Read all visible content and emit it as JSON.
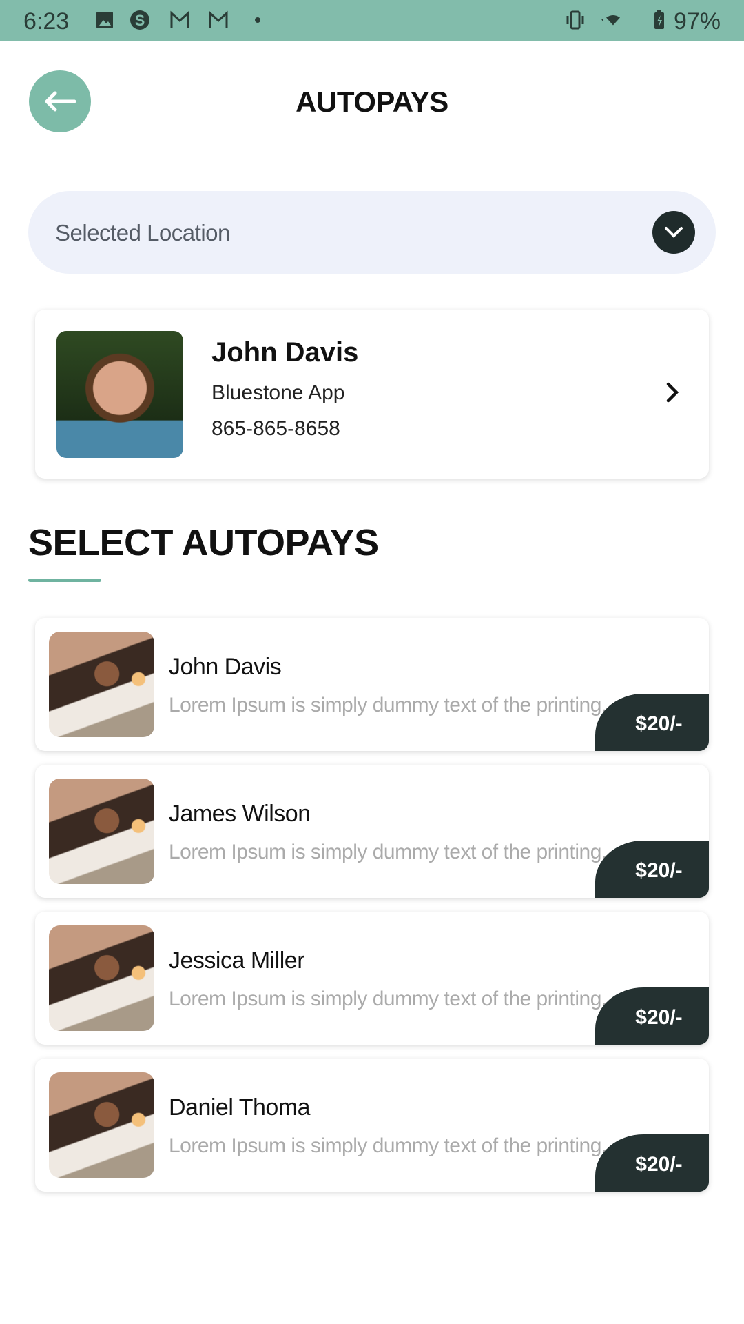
{
  "status_bar": {
    "time": "6:23",
    "battery": "97%",
    "icons": [
      "image-icon",
      "skype-icon",
      "gmail-icon",
      "gmail-icon",
      "dot-icon",
      "vibrate-icon",
      "wifi-icon",
      "battery-charging-icon"
    ]
  },
  "header": {
    "title": "AUTOPAYS",
    "back_icon": "arrow-left-icon"
  },
  "location": {
    "label": "Selected Location"
  },
  "profile": {
    "name": "John Davis",
    "app": "Bluestone App",
    "phone": "865-865-8658"
  },
  "section": {
    "title": "SELECT AUTOPAYS"
  },
  "items": [
    {
      "name": "John Davis",
      "desc": "Lorem Ipsum is simply dummy text of the printing...",
      "price": "$20/-"
    },
    {
      "name": "James Wilson",
      "desc": "Lorem Ipsum is simply dummy text of the printing...",
      "price": "$20/-"
    },
    {
      "name": "Jessica Miller",
      "desc": "Lorem Ipsum is simply dummy text of the printing...",
      "price": "$20/-"
    },
    {
      "name": "Daniel Thoma",
      "desc": "Lorem Ipsum is simply dummy text of the printing...",
      "price": "$20/-"
    }
  ],
  "colors": {
    "accent": "#7dbba8",
    "status": "#82bcab",
    "dark": "#243131",
    "dropdown_bg": "#eef1fa"
  }
}
